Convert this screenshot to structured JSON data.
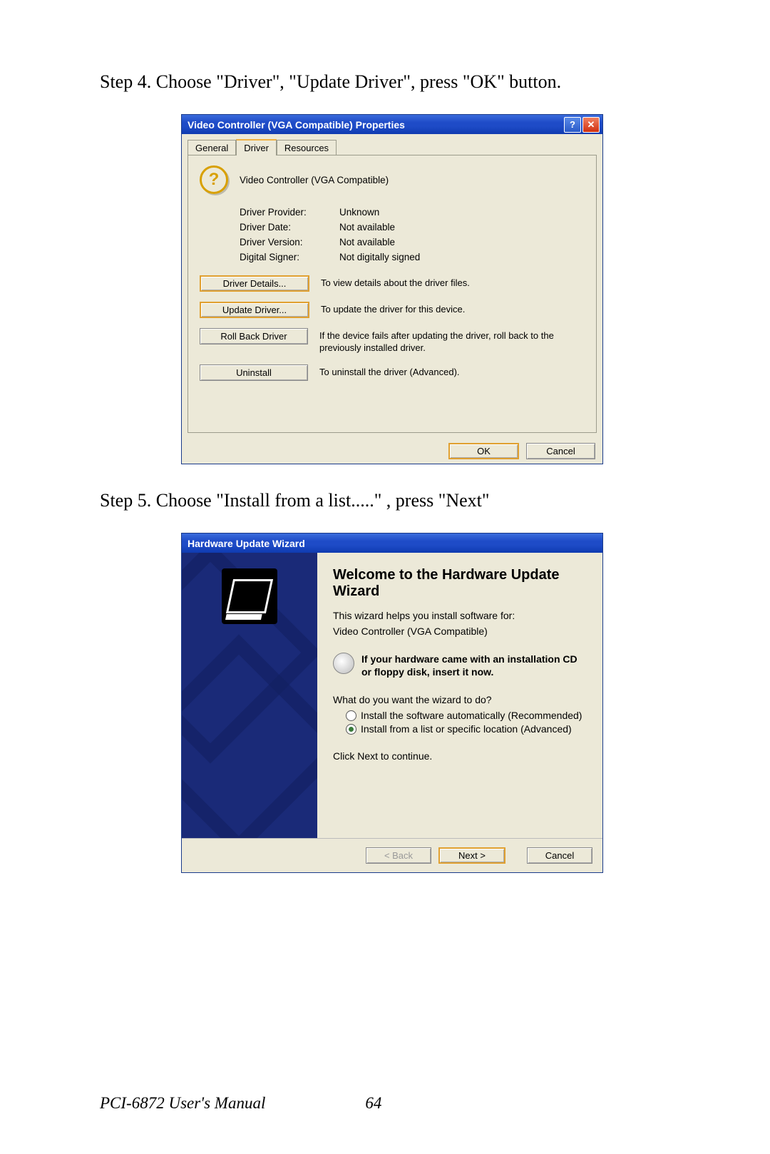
{
  "step4": "Step 4.  Choose \"Driver\", \"Update Driver\", press \"OK\" button.",
  "step5": "Step 5.  Choose \"Install from a list.....\" , press \"Next\"",
  "footer": {
    "manual": "PCI-6872 User's Manual",
    "page": "64"
  },
  "dlg1": {
    "title": "Video Controller (VGA Compatible) Properties",
    "tabs": {
      "general": "General",
      "driver": "Driver",
      "resources": "Resources"
    },
    "device": "Video Controller (VGA Compatible)",
    "rows": {
      "provider_l": "Driver Provider:",
      "provider_v": "Unknown",
      "date_l": "Driver Date:",
      "date_v": "Not available",
      "version_l": "Driver Version:",
      "version_v": "Not available",
      "signer_l": "Digital Signer:",
      "signer_v": "Not digitally signed"
    },
    "btns": {
      "details": "Driver Details...",
      "details_d": "To view details about the driver files.",
      "update": "Update Driver...",
      "update_d": "To update the driver for this device.",
      "rollback": "Roll Back Driver",
      "rollback_d": "If the device fails after updating the driver, roll back to the previously installed driver.",
      "uninstall": "Uninstall",
      "uninstall_d": "To uninstall the driver (Advanced)."
    },
    "ok": "OK",
    "cancel": "Cancel"
  },
  "dlg2": {
    "title": "Hardware Update Wizard",
    "heading": "Welcome to the Hardware Update Wizard",
    "intro": "This wizard helps you install software for:",
    "device": "Video Controller (VGA Compatible)",
    "cd_note": "If your hardware came with an installation CD or floppy disk, insert it now.",
    "question": "What do you want the wizard to do?",
    "opt1": "Install the software automatically (Recommended)",
    "opt2": "Install from a list or specific location (Advanced)",
    "click_next": "Click Next to continue.",
    "back": "< Back",
    "next": "Next >",
    "cancel": "Cancel"
  }
}
